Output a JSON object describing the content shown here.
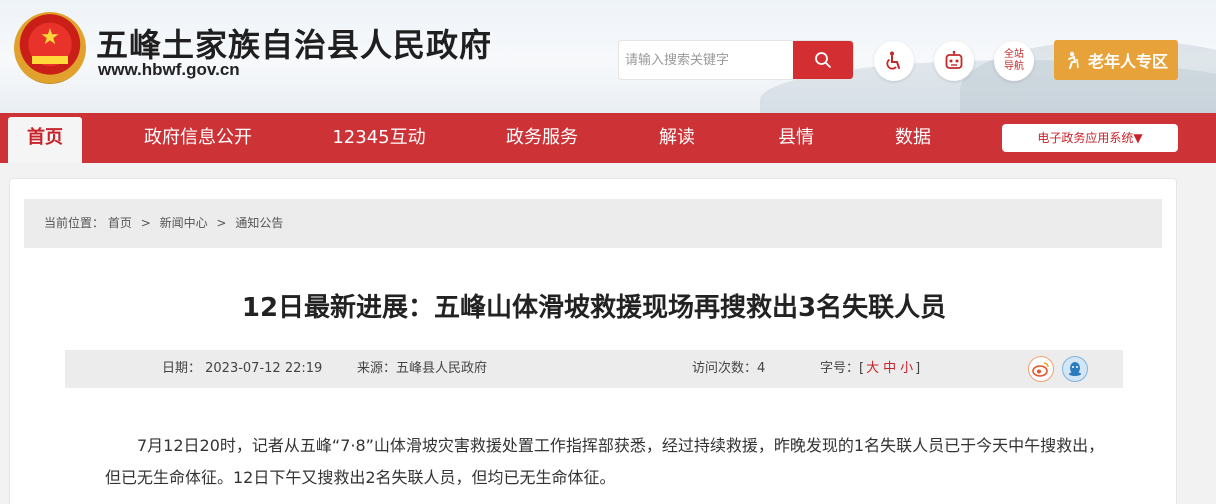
{
  "header": {
    "site_title": "五峰土家族自治县人民政府",
    "site_url": "www.hbwf.gov.cn",
    "search": {
      "placeholder": "请输入搜索关键字"
    },
    "guide_label_1": "全站",
    "guide_label_2": "导航",
    "elder_label": "老年人专区"
  },
  "nav": {
    "items": [
      "首页",
      "政府信息公开",
      "12345互动",
      "政务服务",
      "解读",
      "县情",
      "数据"
    ],
    "app_system": "电子政务应用系统▼"
  },
  "breadcrumb": {
    "prefix": "当前位置：",
    "items": [
      "首页",
      "新闻中心",
      "通知公告"
    ],
    "sep": ">"
  },
  "article": {
    "title": "12日最新进展：五峰山体滑坡救援现场再搜救出3名失联人员",
    "date": "日期：  2023-07-12 22:19",
    "source": "来源：五峰县人民政府",
    "visits": "访问次数：4",
    "font_size_label": "字号：",
    "font_sizes": [
      "大",
      "中",
      "小"
    ],
    "body": "7月12日20时，记者从五峰“7·8”山体滑坡灾害救援处置工作指挥部获悉，经过持续救援，昨晚发现的1名失联人员已于今天中午搜救出，但已无生命体征。12日下午又搜救出2名失联人员，但均已无生命体征。"
  },
  "colors": {
    "nav_red": "#cd3236",
    "elder_orange": "#e8a23a",
    "search_red": "#d32f33"
  }
}
